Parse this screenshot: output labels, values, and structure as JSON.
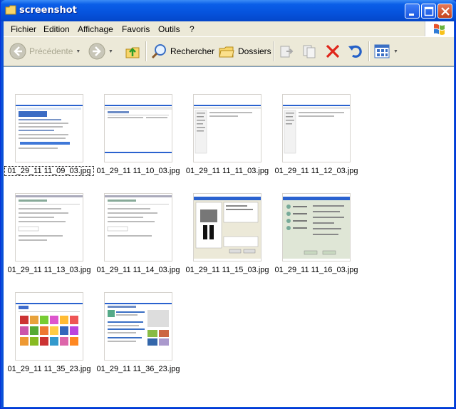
{
  "window": {
    "title": "screenshot"
  },
  "menu": [
    "Fichier",
    "Edition",
    "Affichage",
    "Favoris",
    "Outils",
    "?"
  ],
  "toolbar": {
    "back": "Précédente",
    "search": "Rechercher",
    "folders": "Dossiers"
  },
  "files": [
    {
      "name": "01_29_11 11_09_03.jpg",
      "thumb": "web-blue"
    },
    {
      "name": "01_29_11 11_10_03.jpg",
      "thumb": "web-plain"
    },
    {
      "name": "01_29_11 11_11_03.jpg",
      "thumb": "web-sidebar"
    },
    {
      "name": "01_29_11 11_12_03.jpg",
      "thumb": "web-sidebar"
    },
    {
      "name": "01_29_11 11_13_03.jpg",
      "thumb": "web-form"
    },
    {
      "name": "01_29_11 11_14_03.jpg",
      "thumb": "web-form"
    },
    {
      "name": "01_29_11 11_15_03.jpg",
      "thumb": "dialog-printer"
    },
    {
      "name": "01_29_11 11_16_03.jpg",
      "thumb": "dialog-options"
    },
    {
      "name": "01_29_11 11_35_23.jpg",
      "thumb": "web-photos"
    },
    {
      "name": "01_29_11 11_36_23.jpg",
      "thumb": "web-news"
    }
  ],
  "colors": {
    "titlebar": "#0653dd",
    "content_bg": "#ffffff",
    "chrome": "#ece9d8"
  }
}
